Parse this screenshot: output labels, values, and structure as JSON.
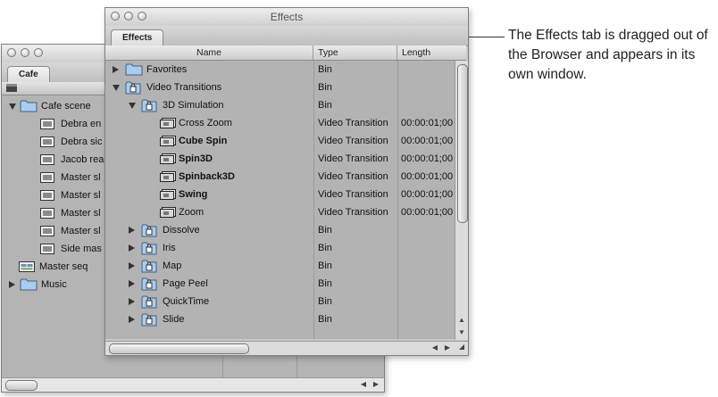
{
  "cafe_window": {
    "tab_label": "Cafe",
    "rows": [
      {
        "name": "Cafe scene",
        "kind": "bin-open",
        "level": 0
      },
      {
        "name": "Debra en",
        "kind": "clip",
        "level": 1
      },
      {
        "name": "Debra sic",
        "kind": "clip",
        "level": 1
      },
      {
        "name": "Jacob rea",
        "kind": "clip",
        "level": 1
      },
      {
        "name": "Master sl",
        "kind": "clip",
        "level": 1
      },
      {
        "name": "Master sl",
        "kind": "clip",
        "level": 1
      },
      {
        "name": "Master sl",
        "kind": "clip",
        "level": 1
      },
      {
        "name": "Master sl",
        "kind": "clip",
        "level": 1
      },
      {
        "name": "Side mas",
        "kind": "clip",
        "level": 1
      },
      {
        "name": "Master seq",
        "kind": "sequence",
        "level": 0
      },
      {
        "name": "Music",
        "kind": "bin-closed",
        "level": 0
      }
    ]
  },
  "effects_window": {
    "title": "Effects",
    "tab_label": "Effects",
    "columns": {
      "name": "Name",
      "type": "Type",
      "length": "Length"
    },
    "rows": [
      {
        "name": "Favorites",
        "type": "Bin",
        "length": "",
        "level": 0,
        "icon": "folder",
        "disclosure": "closed",
        "bold": false
      },
      {
        "name": "Video Transitions",
        "type": "Bin",
        "length": "",
        "level": 0,
        "icon": "lock-bin",
        "disclosure": "open",
        "bold": false
      },
      {
        "name": "3D Simulation",
        "type": "Bin",
        "length": "",
        "level": 1,
        "icon": "lock-bin",
        "disclosure": "open",
        "bold": false
      },
      {
        "name": "Cross Zoom",
        "type": "Video Transition",
        "length": "00:00:01;00",
        "level": 2,
        "icon": "transition",
        "disclosure": "none",
        "bold": false
      },
      {
        "name": "Cube Spin",
        "type": "Video Transition",
        "length": "00:00:01;00",
        "level": 2,
        "icon": "transition",
        "disclosure": "none",
        "bold": true
      },
      {
        "name": "Spin3D",
        "type": "Video Transition",
        "length": "00:00:01;00",
        "level": 2,
        "icon": "transition",
        "disclosure": "none",
        "bold": true
      },
      {
        "name": "Spinback3D",
        "type": "Video Transition",
        "length": "00:00:01;00",
        "level": 2,
        "icon": "transition",
        "disclosure": "none",
        "bold": true
      },
      {
        "name": "Swing",
        "type": "Video Transition",
        "length": "00:00:01;00",
        "level": 2,
        "icon": "transition",
        "disclosure": "none",
        "bold": true
      },
      {
        "name": "Zoom",
        "type": "Video Transition",
        "length": "00:00:01;00",
        "level": 2,
        "icon": "transition",
        "disclosure": "none",
        "bold": false
      },
      {
        "name": "Dissolve",
        "type": "Bin",
        "length": "",
        "level": 1,
        "icon": "lock-bin",
        "disclosure": "closed",
        "bold": false
      },
      {
        "name": "Iris",
        "type": "Bin",
        "length": "",
        "level": 1,
        "icon": "lock-bin",
        "disclosure": "closed",
        "bold": false
      },
      {
        "name": "Map",
        "type": "Bin",
        "length": "",
        "level": 1,
        "icon": "lock-bin",
        "disclosure": "closed",
        "bold": false
      },
      {
        "name": "Page Peel",
        "type": "Bin",
        "length": "",
        "level": 1,
        "icon": "lock-bin",
        "disclosure": "closed",
        "bold": false
      },
      {
        "name": "QuickTime",
        "type": "Bin",
        "length": "",
        "level": 1,
        "icon": "lock-bin",
        "disclosure": "closed",
        "bold": false
      },
      {
        "name": "Slide",
        "type": "Bin",
        "length": "",
        "level": 1,
        "icon": "lock-bin",
        "disclosure": "closed",
        "bold": false
      }
    ]
  },
  "callout": {
    "text": "The Effects tab is dragged out of the Browser and appears in its own window."
  },
  "colors": {
    "list_bg": "#b3b3b3",
    "folder_blue": "#9cc4ec"
  }
}
